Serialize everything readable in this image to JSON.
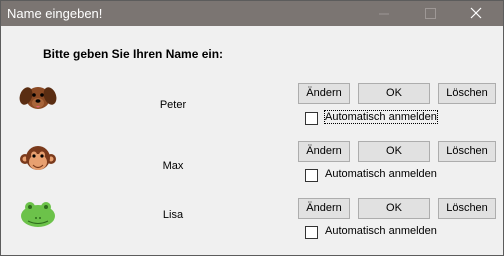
{
  "window": {
    "title": "Name eingeben!"
  },
  "controls": {
    "minimize": "—",
    "maximize": "☐",
    "close": "✕"
  },
  "heading": "Bitte geben Sie Ihren Name ein:",
  "buttons": {
    "aendern": "Ändern",
    "ok": "OK",
    "loeschen": "Löschen"
  },
  "checkbox_label": "Automatisch anmelden",
  "users": [
    {
      "name": "Peter",
      "avatar": "dog-icon",
      "auto_login": false
    },
    {
      "name": "Max",
      "avatar": "monkey-icon",
      "auto_login": false
    },
    {
      "name": "Lisa",
      "avatar": "frog-icon",
      "auto_login": false
    }
  ]
}
